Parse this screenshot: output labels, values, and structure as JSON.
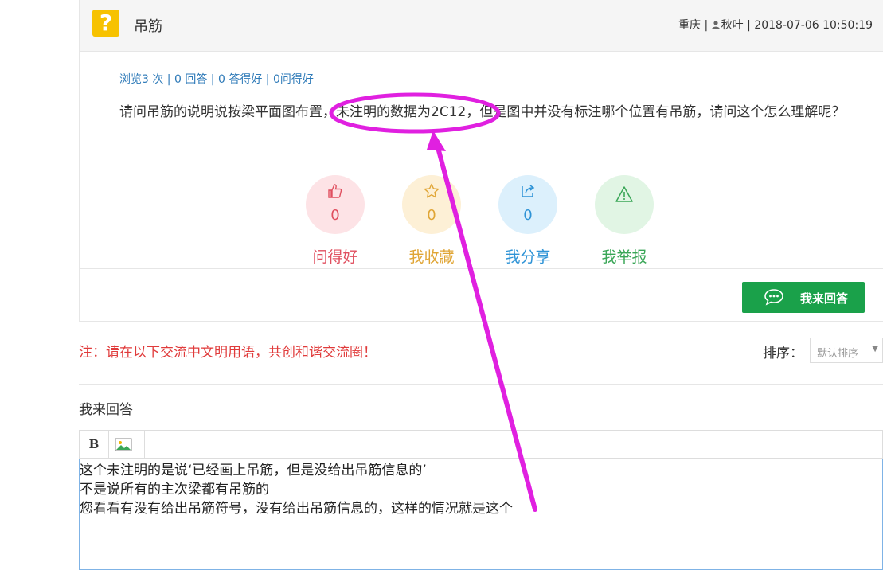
{
  "question": {
    "icon": "question-mark-icon",
    "icon_glyph": "?",
    "title": "吊筋",
    "meta_location": "重庆",
    "meta_sep1": " | ",
    "meta_user": "秋叶",
    "meta_sep2": " | ",
    "meta_time": "2018-07-06 10:50:19",
    "stats": {
      "views": "浏览3 次",
      "answers": "0 回答",
      "good_answers": "0 答得好",
      "good_questions": "0问得好",
      "sep": " | "
    },
    "body": "请问吊筋的说明说按梁平面图布置，未注明的数据为2C12，但是图中并没有标注哪个位置有吊筋，请问这个怎么理解呢？"
  },
  "actions": [
    {
      "icon": "thumbs-up-icon",
      "count": "0",
      "label": "问得好",
      "color": "#e04f5f",
      "bg": "#fde3e6"
    },
    {
      "icon": "star-icon",
      "count": "0",
      "label": "我收藏",
      "color": "#e0a535",
      "bg": "#fdf0d6"
    },
    {
      "icon": "share-icon",
      "count": "0",
      "label": "我分享",
      "color": "#2e93d6",
      "bg": "#dcf0fc"
    },
    {
      "icon": "warning-icon",
      "count": "0",
      "label": "我举报",
      "color": "#3aa657",
      "bg": "#e1f5e4"
    }
  ],
  "answer_button": {
    "label": "我来回答",
    "icon": "chat-icon",
    "color": "#1aa14a"
  },
  "notice": "注：请在以下交流中文明用语，共创和谐交流圈！",
  "sort": {
    "label": "排序：",
    "selected": "默认排序"
  },
  "reply": {
    "title": "我来回答",
    "toolbar": {
      "bold": "B",
      "image_icon": "image-icon"
    },
    "lines": [
      "这个未注明的是说‘已经画上吊筋，但是没给出吊筋信息的’",
      "不是说所有的主次梁都有吊筋的",
      "您看看有没有给出吊筋符号，没有给出吊筋信息的，这样的情况就是这个"
    ]
  },
  "annotation": {
    "color": "#e020e0",
    "shapes": [
      "ellipse",
      "arrow"
    ]
  }
}
